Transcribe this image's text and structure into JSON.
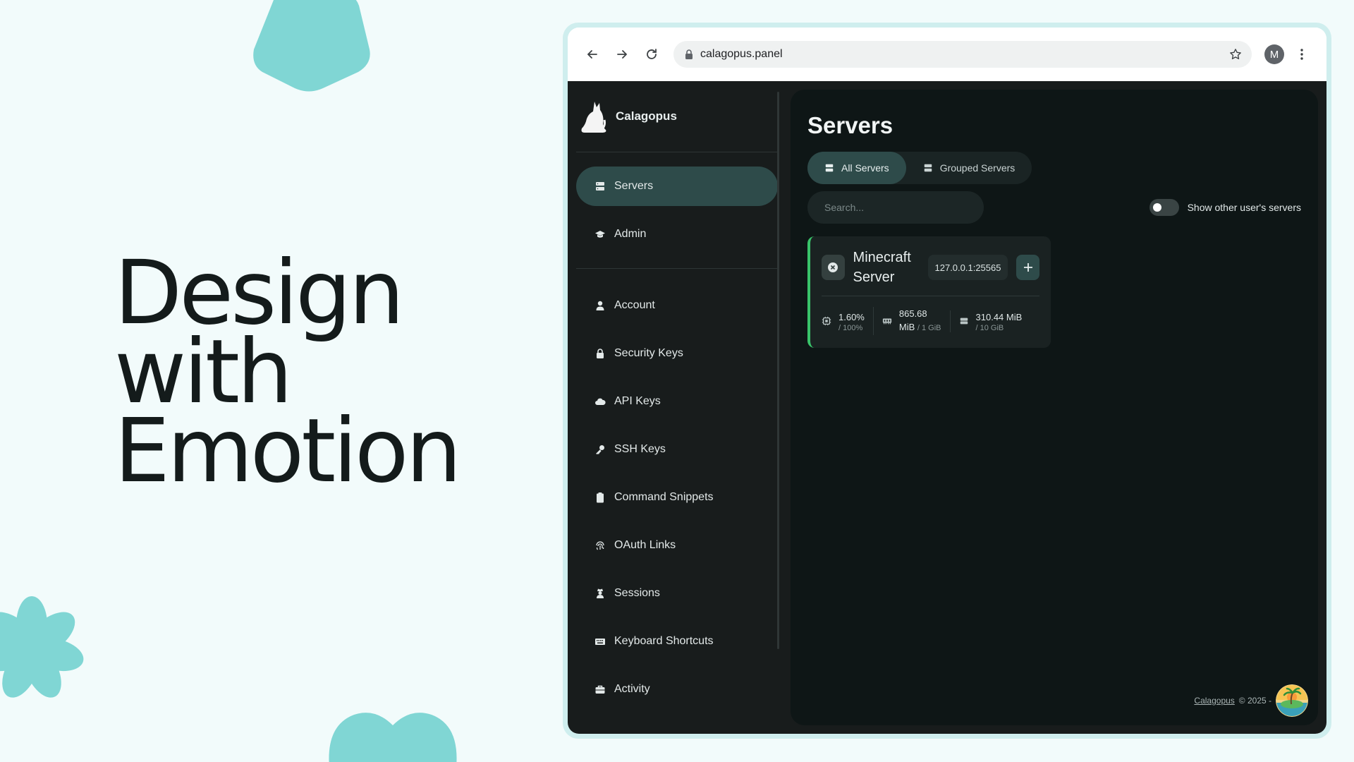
{
  "hero": {
    "line1": "Design",
    "line2": "with",
    "line3": "Emotion"
  },
  "browser": {
    "url": "calagopus.panel",
    "profile_initial": "M"
  },
  "app": {
    "brand": "Calagopus",
    "sidebar": {
      "items": [
        {
          "label": "Servers",
          "icon": "server-icon",
          "active": true
        },
        {
          "label": "Admin",
          "icon": "graduation-cap-icon"
        },
        {
          "label": "Account",
          "icon": "user-icon"
        },
        {
          "label": "Security Keys",
          "icon": "lock-icon"
        },
        {
          "label": "API Keys",
          "icon": "cloud-icon"
        },
        {
          "label": "SSH Keys",
          "icon": "key-icon"
        },
        {
          "label": "Command Snippets",
          "icon": "clipboard-icon"
        },
        {
          "label": "OAuth Links",
          "icon": "fingerprint-icon"
        },
        {
          "label": "Sessions",
          "icon": "user-secret-icon"
        },
        {
          "label": "Keyboard Shortcuts",
          "icon": "keyboard-icon"
        },
        {
          "label": "Activity",
          "icon": "briefcase-icon"
        }
      ]
    },
    "main": {
      "title": "Servers",
      "tabs": [
        {
          "label": "All Servers",
          "active": true
        },
        {
          "label": "Grouped Servers"
        }
      ],
      "search_placeholder": "Search...",
      "toggle_label": "Show other user's servers",
      "toggle_on": false,
      "server": {
        "name": "Minecraft Server",
        "address": "127.0.0.1:25565",
        "status_color": "#39c46a",
        "cpu": {
          "value": "1.60%",
          "limit": "/ 100%"
        },
        "memory": {
          "value": "865.68",
          "unit": "MiB",
          "limit": "/ 1 GiB"
        },
        "disk": {
          "value": "310.44 MiB",
          "limit": "/ 10 GiB"
        }
      },
      "footer": {
        "link": "Calagopus",
        "copyright": "© 2025 -"
      }
    }
  },
  "colors": {
    "accent": "#2e4b4a",
    "deco": "#80d6d4",
    "status_online": "#39c46a"
  }
}
